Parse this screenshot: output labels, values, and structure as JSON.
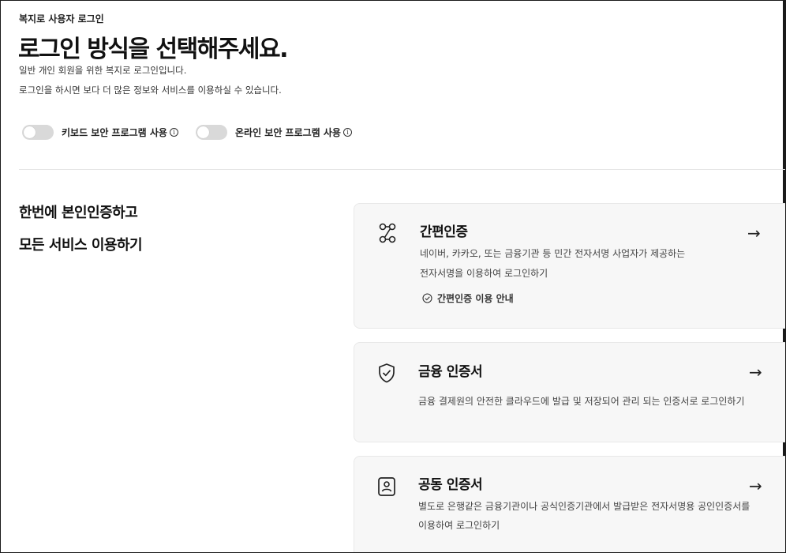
{
  "header": {
    "breadcrumb": "복지로 사용자 로그인",
    "title": "로그인 방식을 선택해주세요.",
    "desc1": "일반 개인 회원을 위한 복지로 로그인입니다.",
    "desc2": "로그인을 하시면 보다 더 많은 정보와 서비스를 이용하실 수 있습니다."
  },
  "toggles": [
    {
      "label": "키보드 보안 프로그램 사용",
      "info": "i"
    },
    {
      "label": "온라인 보안 프로그램 사용",
      "info": "i"
    }
  ],
  "side": {
    "line1": "한번에 본인인증하고",
    "line2": "모든 서비스 이용하기"
  },
  "cards": [
    {
      "title": "간편인증",
      "text1": "네이버, 카카오, 또는 금융기관 등 민간 전자서명 사업자가 제공하는",
      "text2": "전자서명을 이용하여 로그인하기",
      "guide": "간편인증 이용 안내",
      "arrow": "→",
      "icon": "share-nodes-icon"
    },
    {
      "title": "금융 인증서",
      "text1": "금융 결제원의 안전한 클라우드에 발급 및 저장되어 관리 되는 인증서로 로그인하기",
      "arrow": "→",
      "icon": "shield-check-icon"
    },
    {
      "title": "공동 인증서",
      "text1": "별도로 은행같은 금융기관이나 공식인증기관에서 발급받은 전자서명용 공인인증서를",
      "text2": "이용하여 로그인하기",
      "arrow": "→",
      "icon": "id-badge-icon"
    }
  ]
}
